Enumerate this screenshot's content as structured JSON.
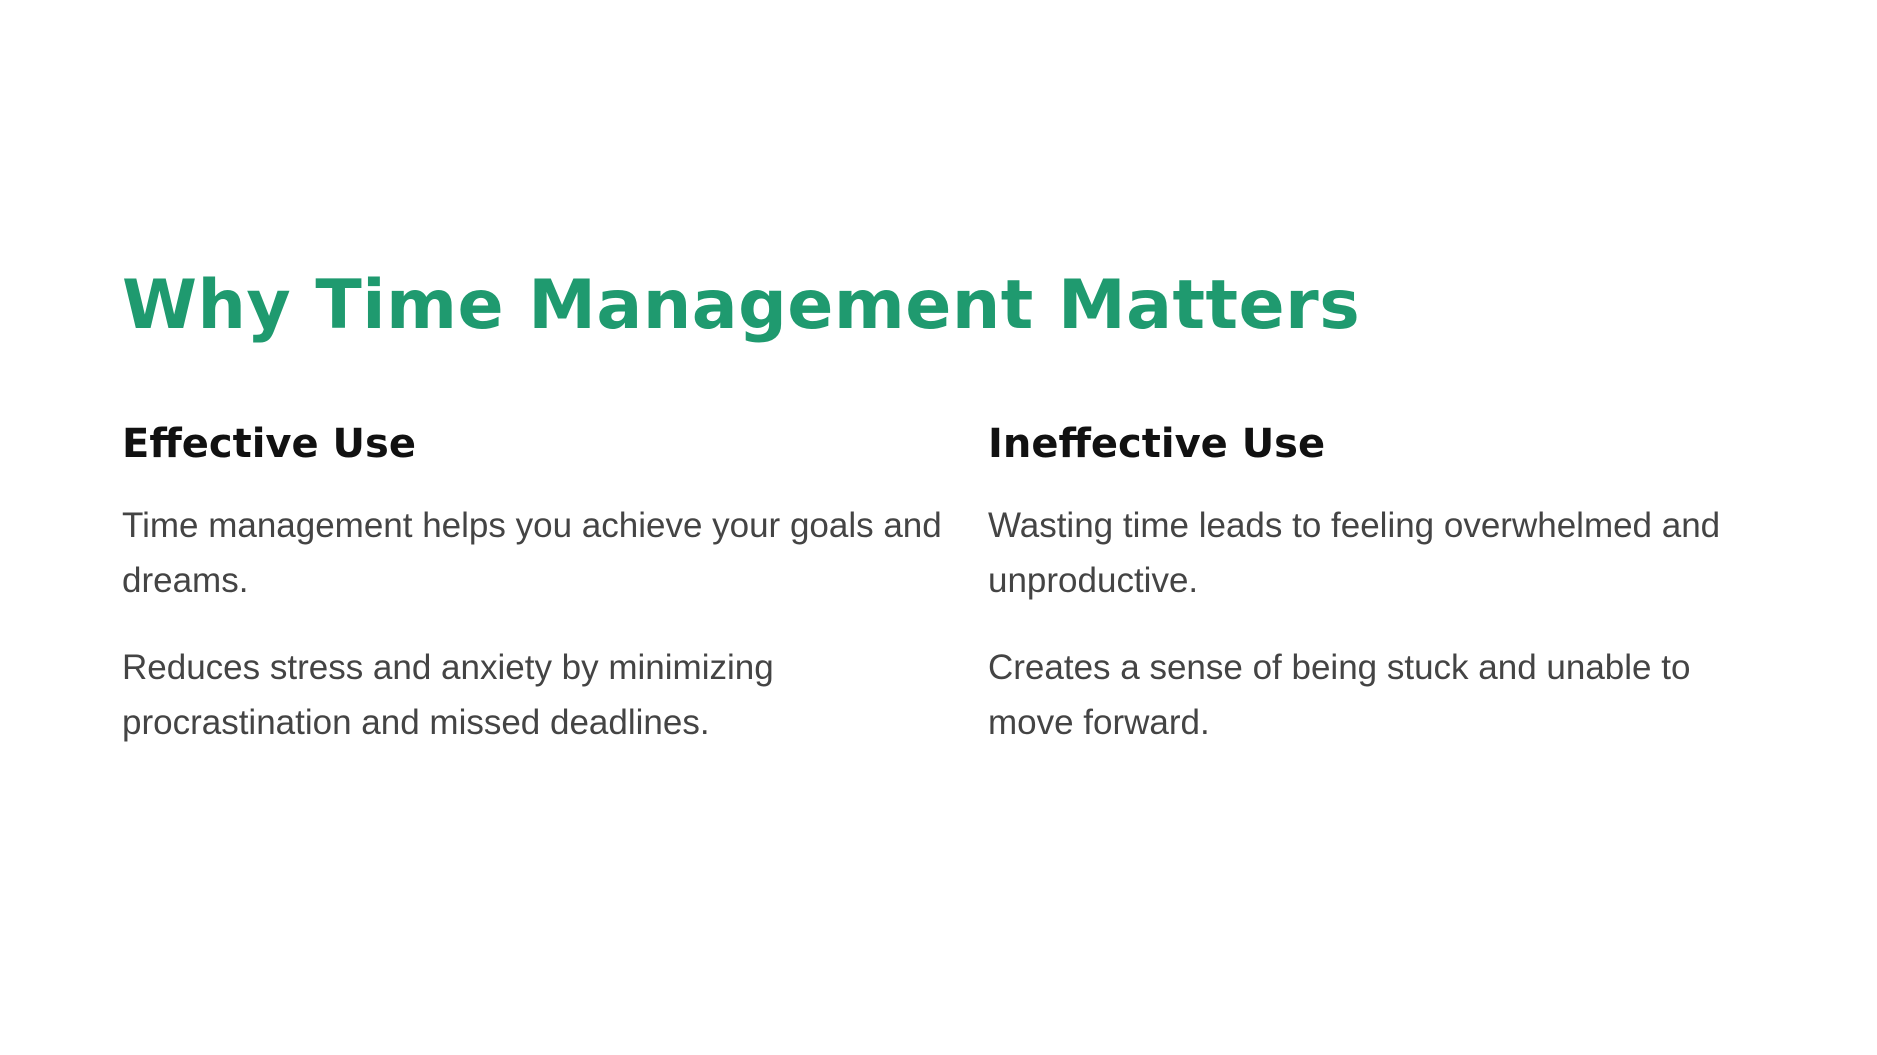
{
  "slide": {
    "title": "Why Time Management Matters",
    "accent_color": "#1f9a6f",
    "columns": [
      {
        "heading": "Effective Use",
        "paragraphs": [
          "Time management helps you achieve your goals and dreams.",
          "Reduces stress and anxiety by minimizing procrastination and missed deadlines."
        ]
      },
      {
        "heading": "Ineffective Use",
        "paragraphs": [
          "Wasting time leads to feeling overwhelmed and unproductive.",
          "Creates a sense of being stuck and unable to move forward."
        ]
      }
    ]
  }
}
